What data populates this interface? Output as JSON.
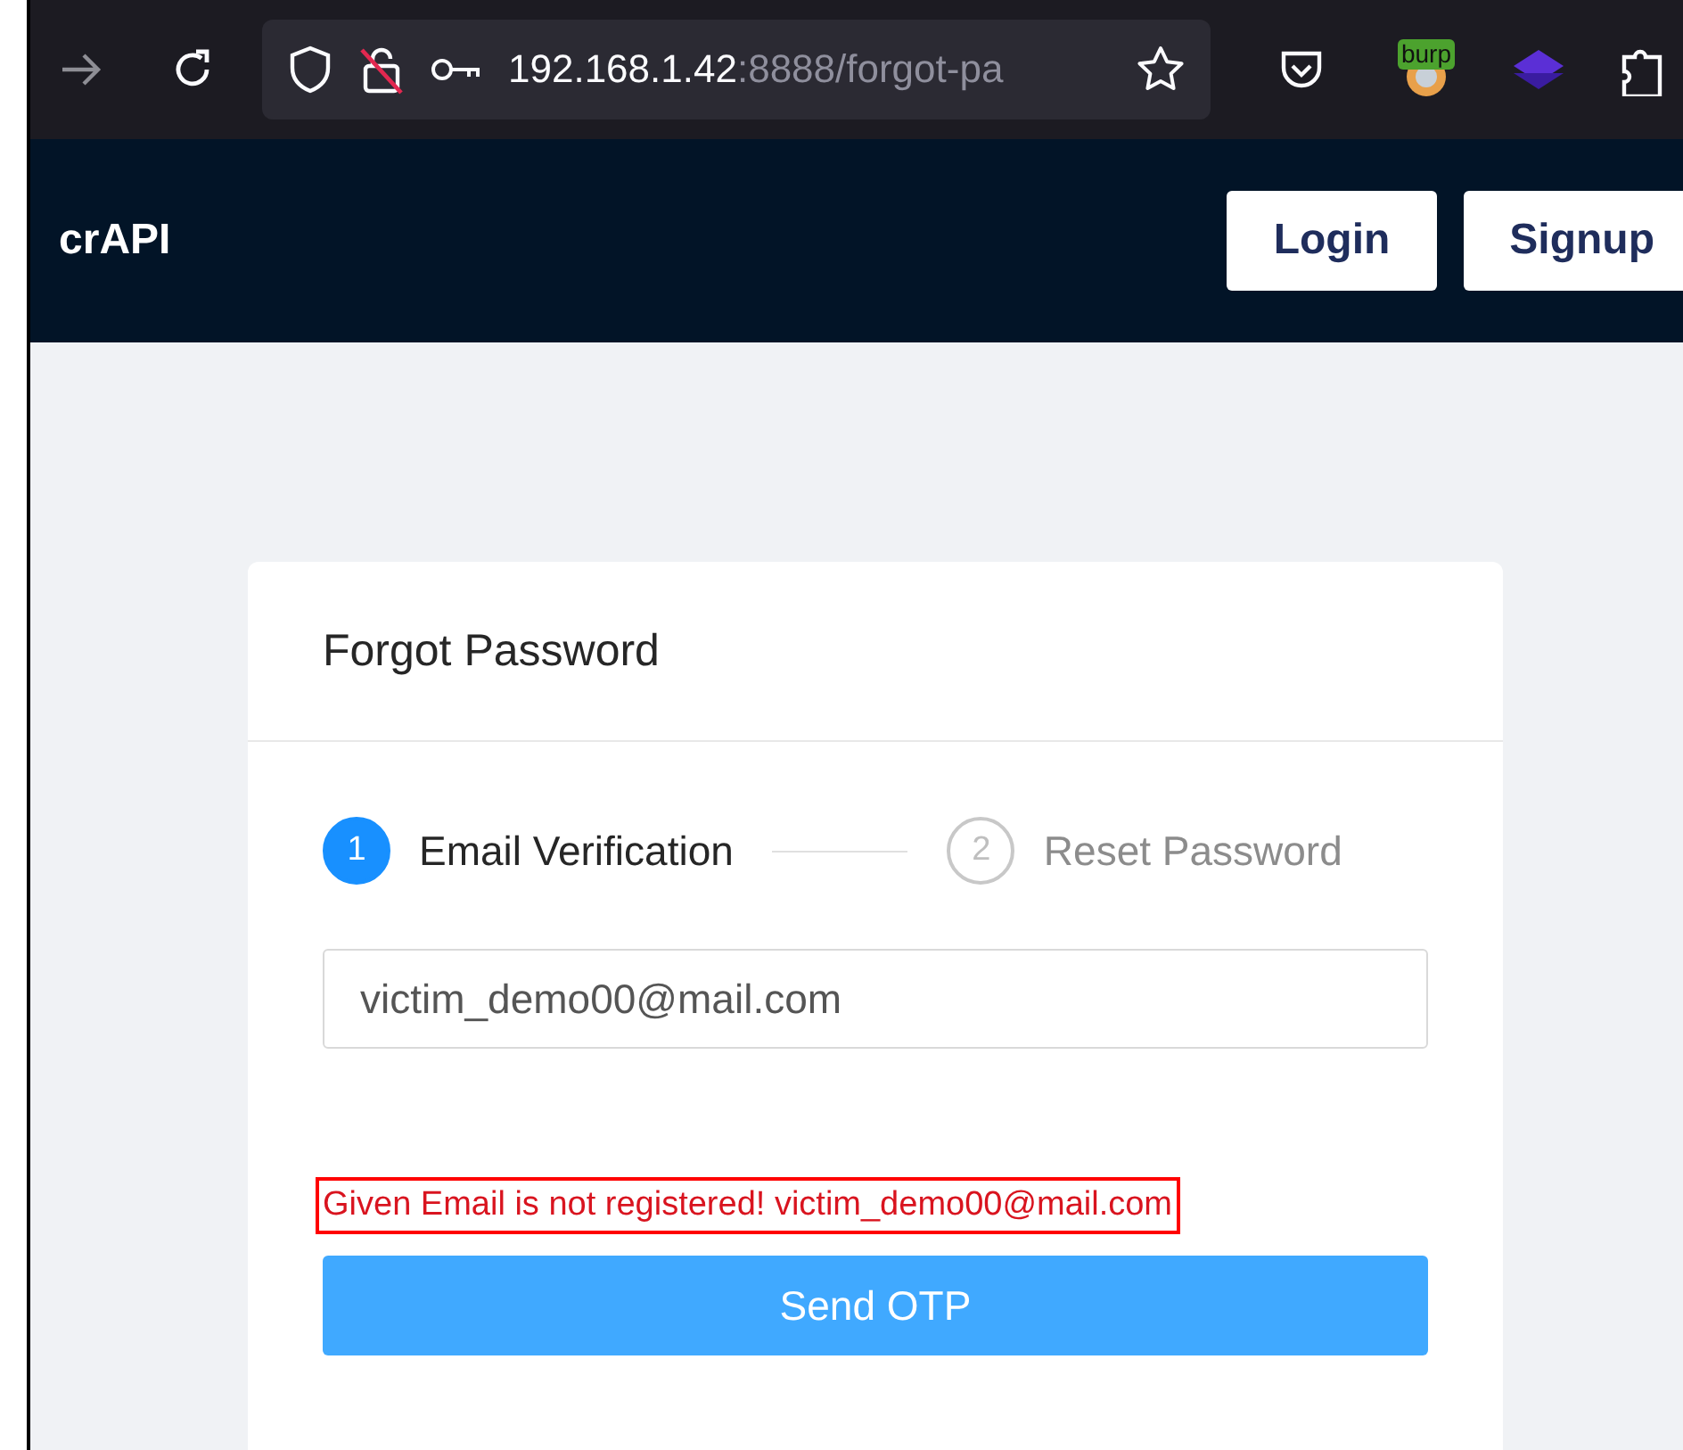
{
  "browser": {
    "url_host": "192.168.1.42",
    "url_rest": ":8888/forgot-pa",
    "extension_badge": "burp"
  },
  "navbar": {
    "brand": "crAPI",
    "buttons": [
      "Login",
      "Signup"
    ]
  },
  "card": {
    "title": "Forgot Password",
    "steps": [
      {
        "number": "1",
        "label": "Email Verification",
        "selected": true
      },
      {
        "number": "2",
        "label": "Reset Password",
        "selected": false
      }
    ],
    "email_field": {
      "value": "victim_demo00@mail.com"
    },
    "error": {
      "text": "Given Email is not registered! victim_demo00@mail.com",
      "highlighted": true
    },
    "submit": "Send OTP"
  }
}
